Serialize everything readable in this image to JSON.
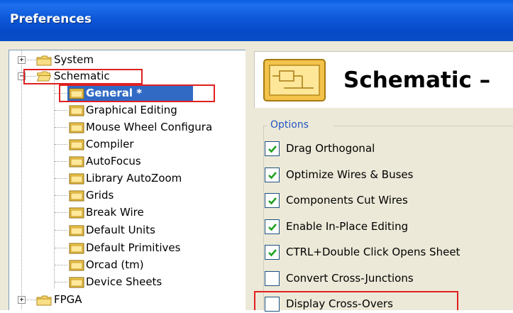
{
  "window": {
    "title": "Preferences"
  },
  "tree": {
    "items": [
      {
        "label": "System",
        "type": "folder",
        "expander": "+"
      },
      {
        "label": "Schematic",
        "type": "folder-open",
        "expander": "−"
      },
      {
        "label": "General *",
        "type": "page",
        "selected": true
      },
      {
        "label": "Graphical Editing",
        "type": "page"
      },
      {
        "label": "Mouse Wheel Configura",
        "type": "page"
      },
      {
        "label": "Compiler",
        "type": "page"
      },
      {
        "label": "AutoFocus",
        "type": "page"
      },
      {
        "label": "Library AutoZoom",
        "type": "page"
      },
      {
        "label": "Grids",
        "type": "page"
      },
      {
        "label": "Break Wire",
        "type": "page"
      },
      {
        "label": "Default Units",
        "type": "page"
      },
      {
        "label": "Default Primitives",
        "type": "page"
      },
      {
        "label": "Orcad (tm)",
        "type": "page"
      },
      {
        "label": "Device Sheets",
        "type": "page"
      },
      {
        "label": "FPGA",
        "type": "folder",
        "expander": "+"
      }
    ]
  },
  "panel": {
    "header_title": "Schematic –",
    "group_label": "Options",
    "options": [
      {
        "label": "Drag Orthogonal",
        "checked": true
      },
      {
        "label": "Optimize Wires & Buses",
        "checked": true
      },
      {
        "label": "Components Cut Wires",
        "checked": true
      },
      {
        "label": "Enable In-Place Editing",
        "checked": true
      },
      {
        "label": "CTRL+Double Click Opens Sheet",
        "checked": true
      },
      {
        "label": "Convert Cross-Junctions",
        "checked": false
      },
      {
        "label": "Display Cross-Overs",
        "checked": false
      }
    ]
  },
  "colors": {
    "title_bar": "#0a4fc8",
    "selection": "#316ac5",
    "highlight_box": "#e02020",
    "group_label": "#2356c2"
  }
}
